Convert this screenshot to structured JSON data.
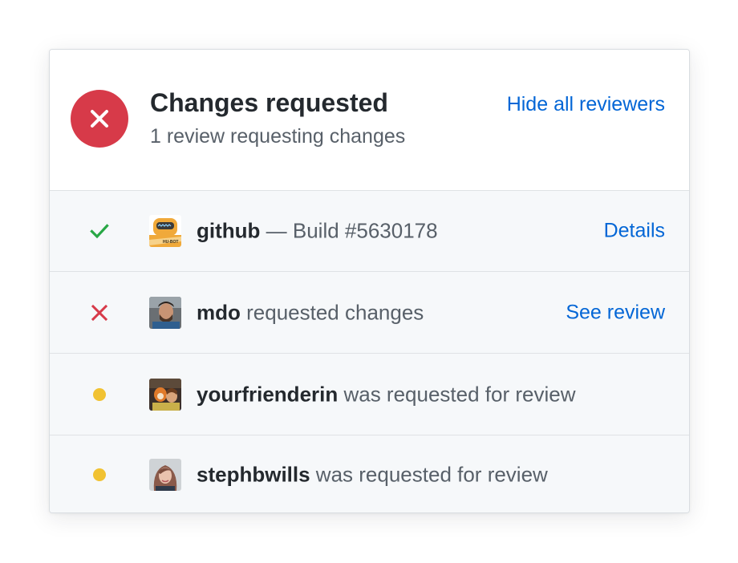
{
  "header": {
    "title": "Changes requested",
    "subtitle": "1 review requesting changes",
    "hide_link": "Hide all reviewers"
  },
  "colors": {
    "danger": "#d73a49",
    "success": "#28a745",
    "pending": "#f1c232",
    "link": "#0366d6"
  },
  "rows": [
    {
      "status": "success",
      "status_icon": "check-icon",
      "avatar": "hubot-avatar",
      "user": "github",
      "text": " — Build #5630178",
      "link": "Details"
    },
    {
      "status": "changes-requested",
      "status_icon": "x-icon",
      "avatar": "mdo-avatar",
      "user": "mdo",
      "text": " requested changes",
      "link": "See review"
    },
    {
      "status": "pending",
      "status_icon": "dot-icon",
      "avatar": "yourfrienderin-avatar",
      "user": "yourfrienderin",
      "text": " was requested for review"
    },
    {
      "status": "pending",
      "status_icon": "dot-icon",
      "avatar": "stephbwills-avatar",
      "user": "stephbwills",
      "text": " was requested for review"
    }
  ]
}
